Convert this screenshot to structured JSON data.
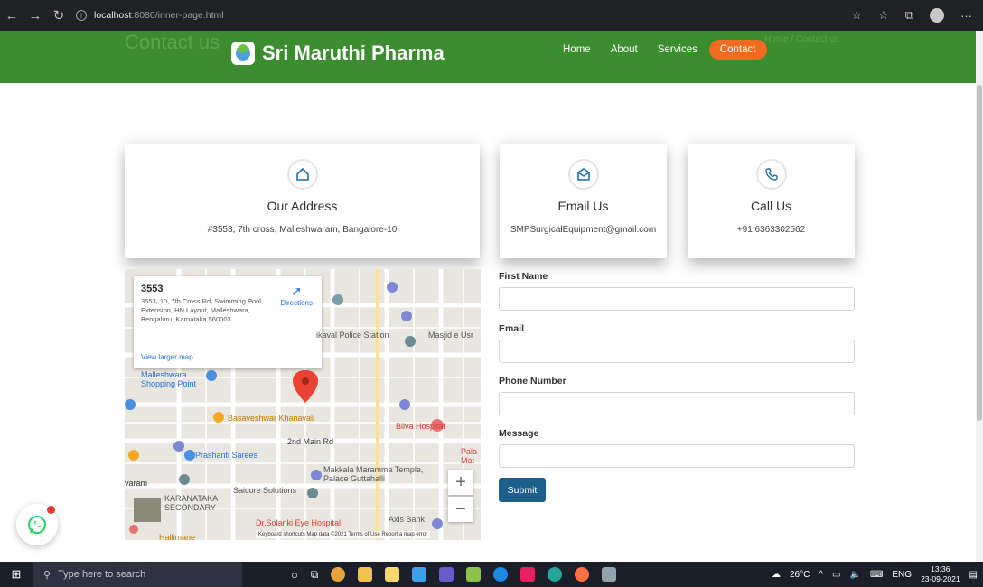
{
  "browser": {
    "url_host": "localhost",
    "url_path": ":8080/inner-page.html"
  },
  "header": {
    "ghost_title": "Contact us",
    "ghost_breadcrumb": "Home / Contact us",
    "brand": "Sri Maruthi Pharma",
    "nav": [
      "Home",
      "About",
      "Services",
      "Contact"
    ],
    "active_nav": "Contact"
  },
  "cards": {
    "address": {
      "title": "Our Address",
      "text": "#3553, 7th cross, Malleshwaram, Bangalore-10"
    },
    "email": {
      "title": "Email Us",
      "text": "SMPSurgicalEquipment@gmail.com"
    },
    "call": {
      "title": "Call Us",
      "text": "+91 6363302562"
    }
  },
  "map": {
    "place_name": "3553",
    "place_address": "3553, 10, 7th Cross Rd, Swimming Pool Extension, HN Layout, Malleshwara, Bengaluru, Karnataka 560003",
    "directions": "Directions",
    "view_larger": "View larger map",
    "labels": {
      "malleshwara": "Malleshwara Shopping Point",
      "basaveshwar": "Basaveshwar Khanavali",
      "police": "ikaval Police Station",
      "masjid": "Masjid e Usr",
      "bilva": "Bilva Hospital",
      "main_rd": "2nd Main Rd",
      "prashanti": "Prashanti Sarees",
      "makkala": "Makkala Maramma Temple, Palace Guttahalli",
      "saicore": "Saicore Solutions",
      "karnataka": "KARANATAKA SECONDARY",
      "solanki": "Dr.Solanki Eye Hospital",
      "axis": "Axis Bank",
      "hallimane": "Hallimane",
      "palace": "Pala Mat",
      "varam": "varam"
    },
    "footer": "Keyboard shortcuts   Map data ©2021   Terms of Use   Report a map error",
    "zoom_in": "+",
    "zoom_out": "−"
  },
  "form": {
    "first_name_label": "First Name",
    "email_label": "Email",
    "phone_label": "Phone Number",
    "message_label": "Message",
    "submit": "Submit"
  },
  "taskbar": {
    "search_placeholder": "Type here to search",
    "temperature": "26°C",
    "language": "ENG",
    "time": "13:36",
    "date": "23-09-2021"
  },
  "colors": {
    "header_green": "#3b8d2f",
    "contact_orange": "#f36b21",
    "submit_blue": "#1d5f8a",
    "icon_blue": "#1e6fa5"
  }
}
